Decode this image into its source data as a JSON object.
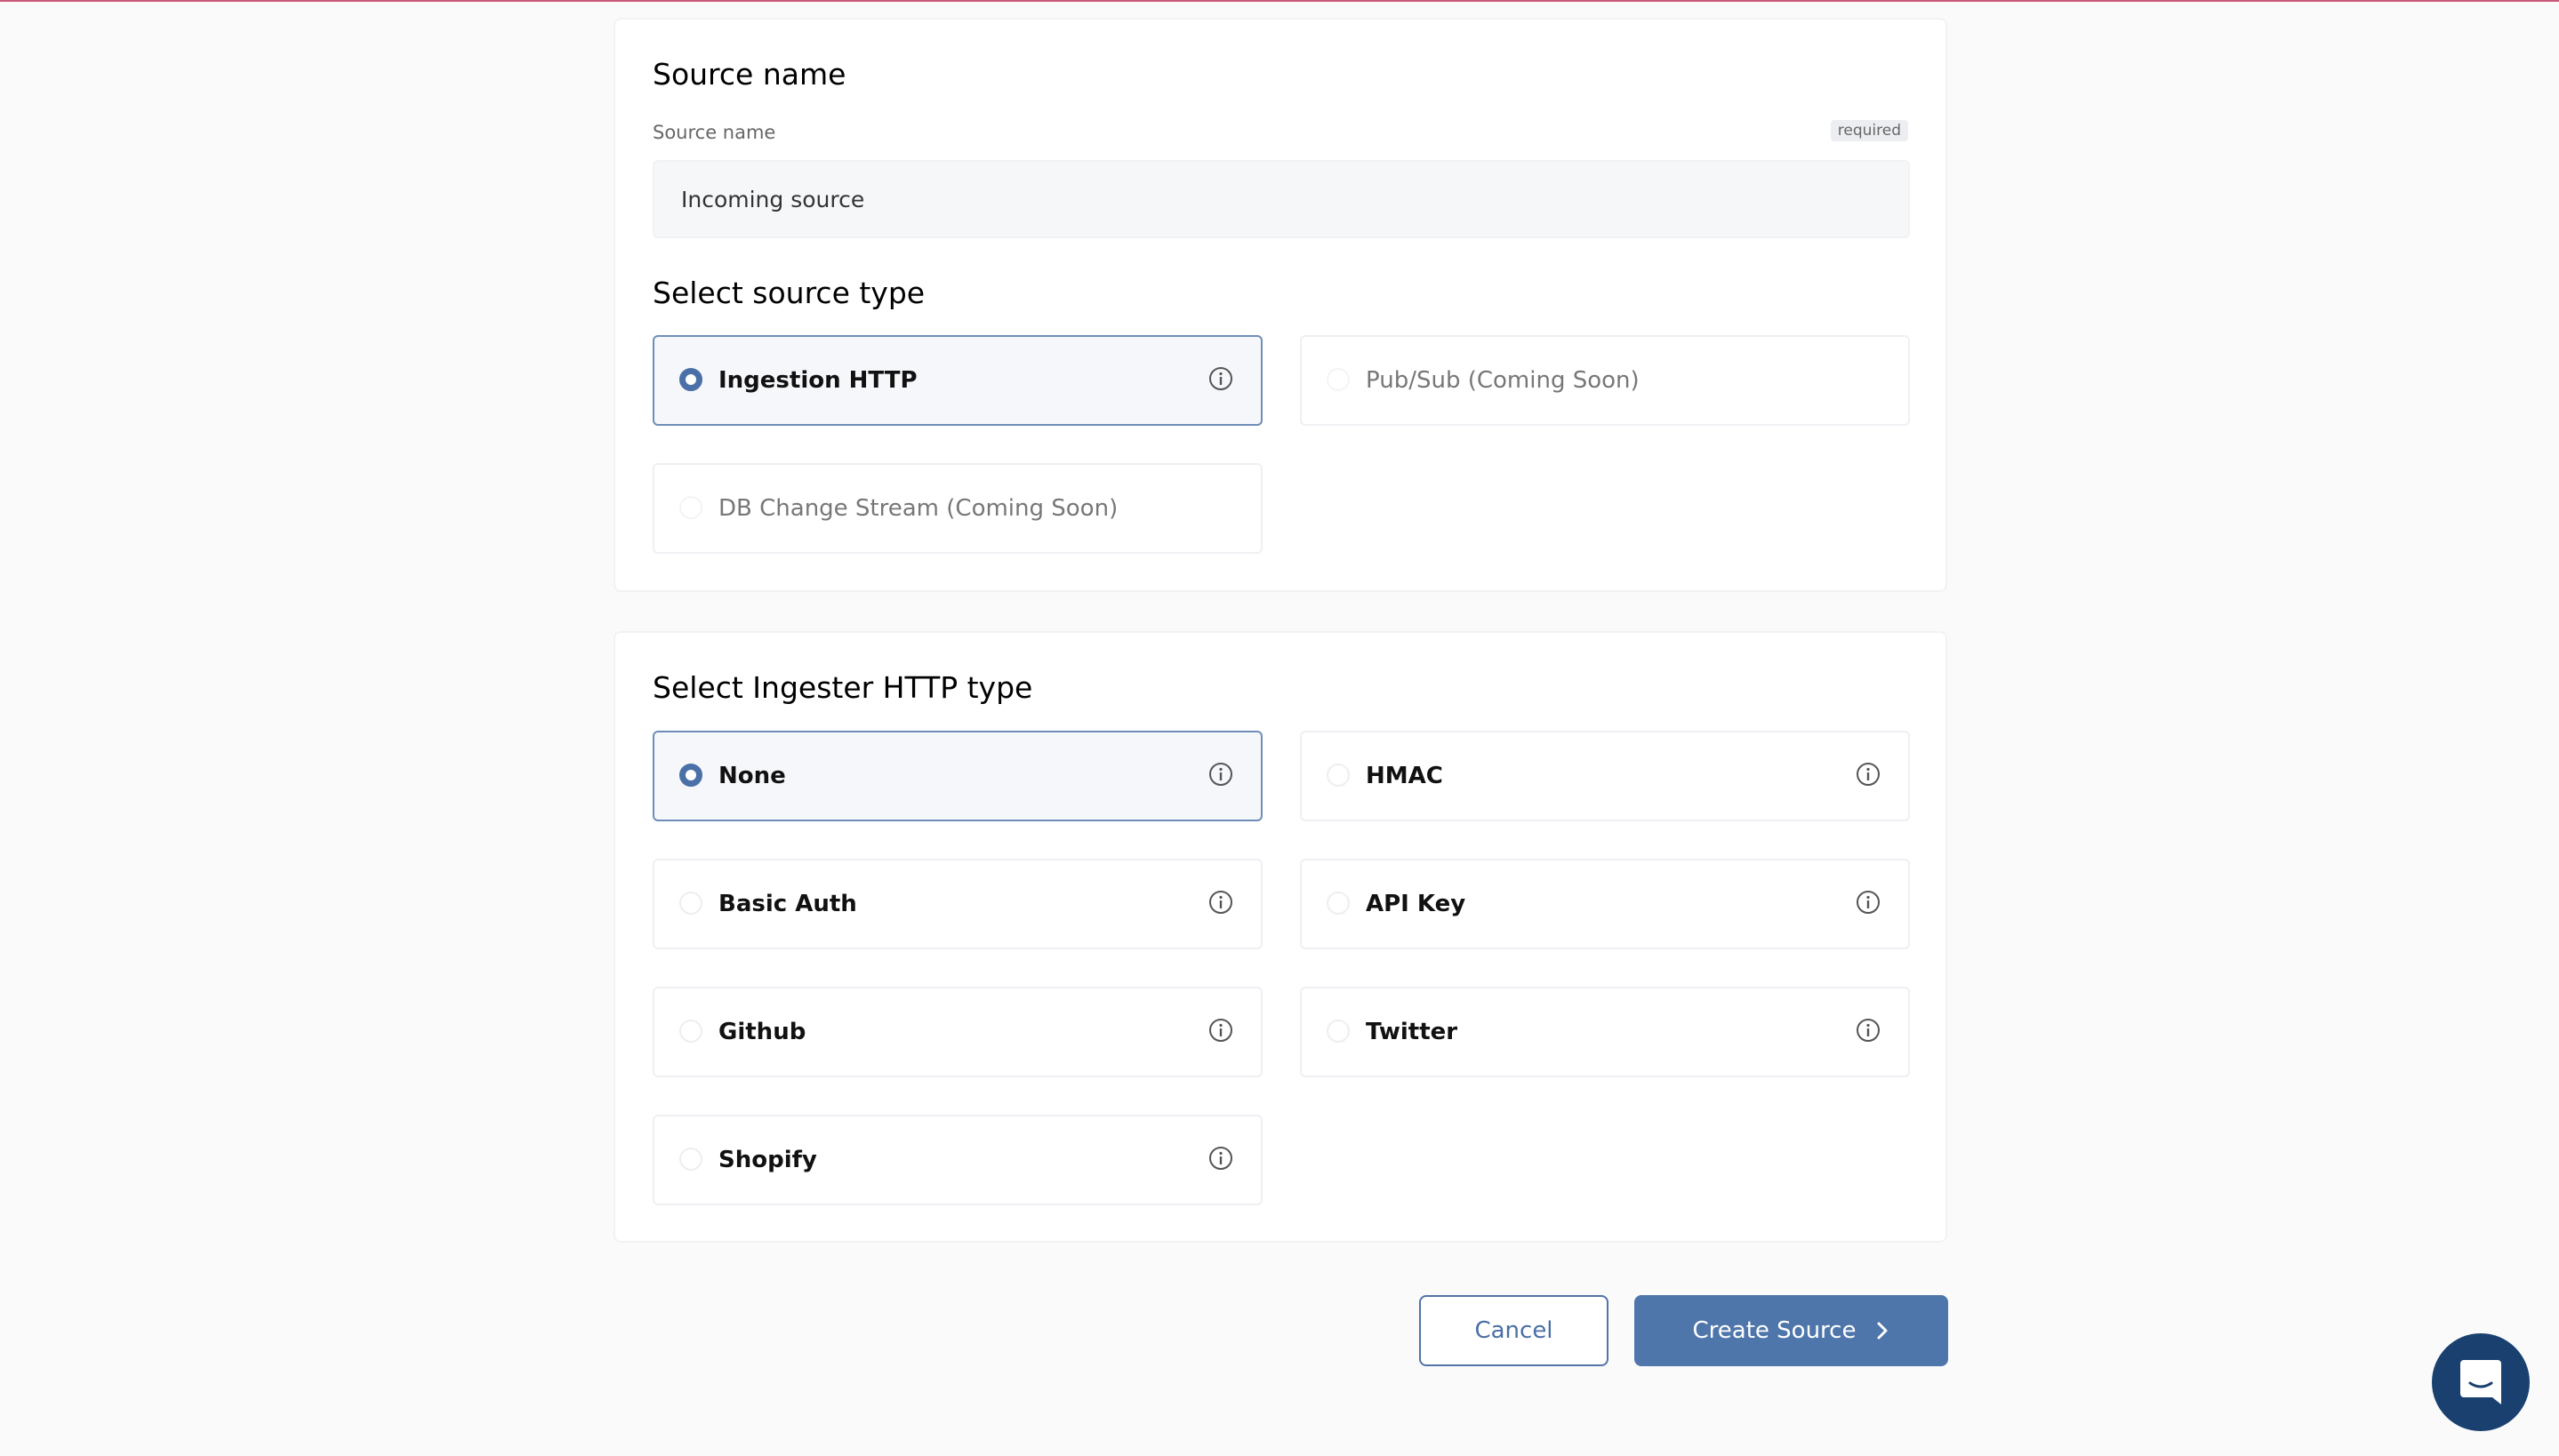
{
  "source_name_section": {
    "heading": "Source name",
    "field_label": "Source name",
    "required_badge": "required",
    "input_value": "Incoming source"
  },
  "source_type_section": {
    "heading": "Select source type",
    "options": [
      {
        "label": "Ingestion HTTP",
        "selected": true,
        "disabled": false,
        "icon": "info-icon"
      },
      {
        "label": "Pub/Sub (Coming Soon)",
        "selected": false,
        "disabled": true
      },
      {
        "label": "DB Change Stream (Coming Soon)",
        "selected": false,
        "disabled": true
      }
    ]
  },
  "ingester_section": {
    "heading": "Select Ingester HTTP type",
    "options": [
      {
        "label": "None",
        "selected": true,
        "icon": "info-icon"
      },
      {
        "label": "HMAC",
        "selected": false,
        "icon": "info-icon"
      },
      {
        "label": "Basic Auth",
        "selected": false,
        "icon": "info-icon"
      },
      {
        "label": "API Key",
        "selected": false,
        "icon": "info-icon"
      },
      {
        "label": "Github",
        "selected": false,
        "icon": "info-icon"
      },
      {
        "label": "Twitter",
        "selected": false,
        "icon": "info-icon"
      },
      {
        "label": "Shopify",
        "selected": false,
        "icon": "info-icon"
      }
    ]
  },
  "actions": {
    "cancel_label": "Cancel",
    "create_label": "Create Source",
    "create_icon": "chevron-right-icon"
  },
  "chat_widget": {
    "icon": "chat-bubble-icon"
  },
  "colors": {
    "accent": "#4f76ab",
    "selected_border": "#6f8db8",
    "top_line": "#c9587a",
    "chat_launcher": "#19406f"
  }
}
